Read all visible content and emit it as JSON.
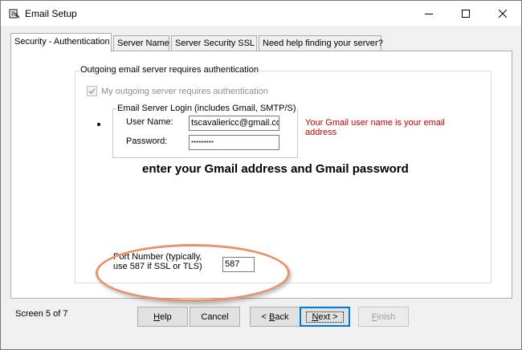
{
  "window": {
    "title": "Email Setup",
    "icon": "app-settings-icon",
    "controls": {
      "minimize_icon": "minimize-icon",
      "maximize_icon": "maximize-icon",
      "close_icon": "close-icon"
    }
  },
  "tabs": [
    {
      "label": "Security - Authentication",
      "active": true
    },
    {
      "label": "Server Name",
      "active": false
    },
    {
      "label": "Server Security SSL",
      "active": false
    },
    {
      "label": "Need help finding your server?",
      "active": false
    }
  ],
  "auth_group": {
    "legend": "Outgoing email server requires authentication",
    "checkbox_label": "My outgoing server requires authentication",
    "checkbox_checked": true,
    "checkbox_disabled": true
  },
  "login_group": {
    "legend": "Email Server Login (includes Gmail, SMTP/S)",
    "radio_selected": true,
    "username_label": "User Name:",
    "username_value": "tscavaliericc@gmail.co",
    "password_label": "Password:",
    "password_value": "*********"
  },
  "gmail_hint": "Your Gmail user name is your email address",
  "instruction": "enter your Gmail address and Gmail password",
  "port": {
    "label_line1": "Port Number (typically,",
    "label_line2": "use 587 if SSL or TLS)",
    "value": "587"
  },
  "colors": {
    "hint_red": "#c00000",
    "highlight_orange": "#e9916a",
    "default_button_border": "#0078d7"
  },
  "footer": {
    "status": "Screen 5 of 7",
    "buttons": {
      "help": {
        "mnemonic": "H",
        "rest": "elp"
      },
      "cancel": "Cancel",
      "back": {
        "prefix": "< ",
        "mnemonic": "B",
        "rest": "ack"
      },
      "next": {
        "mnemonic": "N",
        "rest": "ext >"
      },
      "finish": {
        "mnemonic": "F",
        "rest": "inish"
      }
    }
  }
}
